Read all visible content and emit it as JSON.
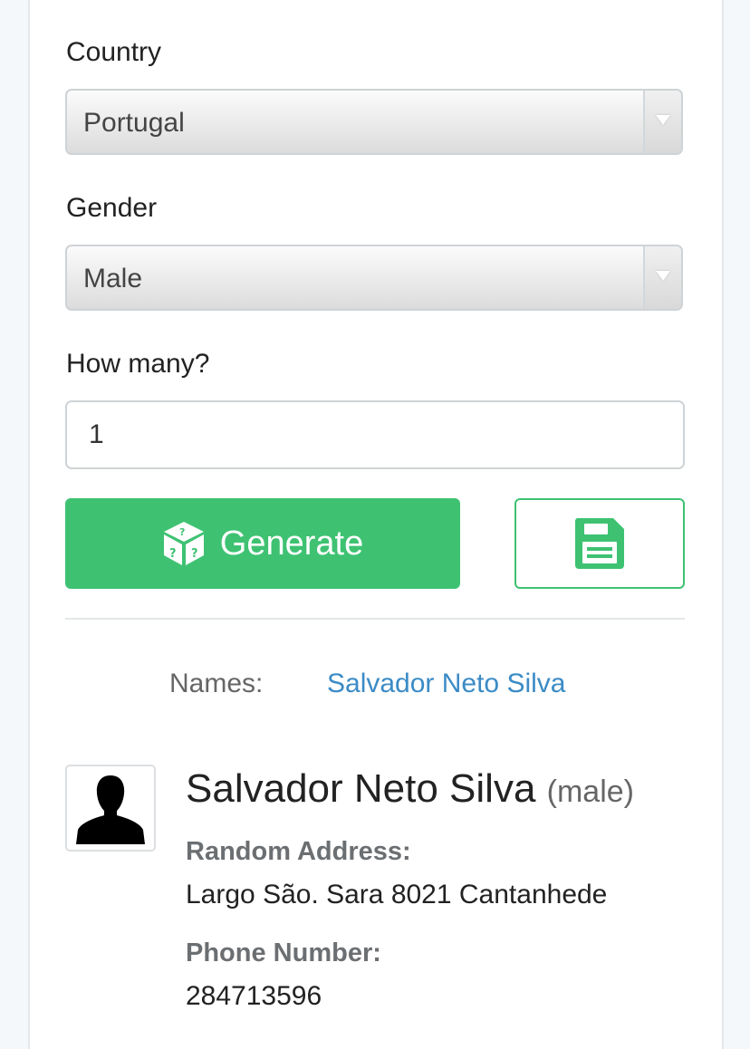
{
  "form": {
    "country_label": "Country",
    "country_value": "Portugal",
    "gender_label": "Gender",
    "gender_value": "Male",
    "count_label": "How many?",
    "count_value": "1",
    "generate_label": "Generate",
    "generate_icon": "dice-icon",
    "save_icon": "floppy-save-icon"
  },
  "results": {
    "names_label": "Names:",
    "names_link": "Salvador Neto Silva"
  },
  "person": {
    "avatar_icon": "person-silhouette-icon",
    "name": "Salvador Neto Silva",
    "gender": "(male)",
    "address_label": "Random Address:",
    "address": "Largo São. Sara 8021 Cantanhede",
    "phone_label": "Phone Number:",
    "phone": "284713596"
  },
  "colors": {
    "accent_green": "#3ec272",
    "link_blue": "#3b8bc6"
  }
}
